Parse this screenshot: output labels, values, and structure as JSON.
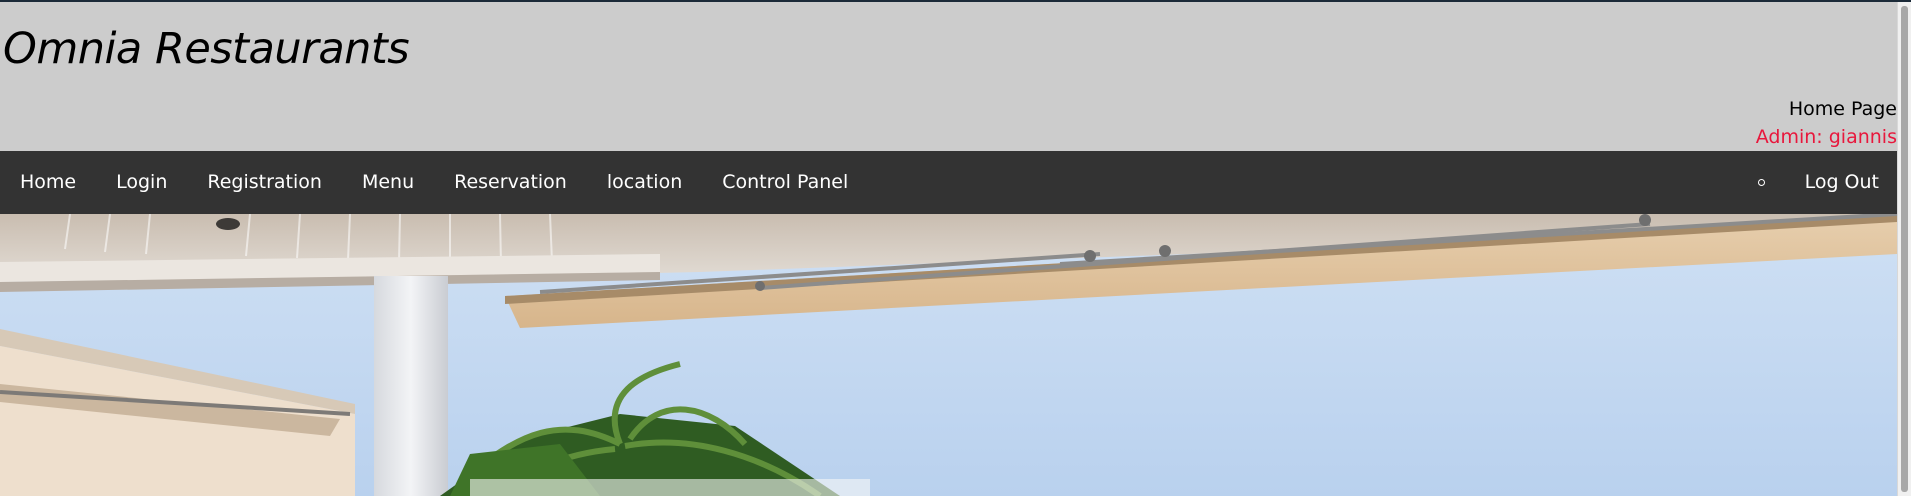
{
  "header": {
    "site_title": "Omnia Restaurants",
    "page_label": "Home Page",
    "admin_label": "Admin: giannis",
    "admin_color": "#e8173c",
    "background_color": "#cccccc"
  },
  "navbar": {
    "background_color": "#333333",
    "items": [
      {
        "label": "Home"
      },
      {
        "label": "Login"
      },
      {
        "label": "Registration"
      },
      {
        "label": "Menu"
      },
      {
        "label": "Reservation"
      },
      {
        "label": "location"
      },
      {
        "label": "Control Panel"
      }
    ],
    "bullet_icon": "circle-bullet-icon",
    "logout_label": "Log Out"
  },
  "hero": {
    "image": "restaurant-terrace-with-awnings-and-palm-tree"
  }
}
